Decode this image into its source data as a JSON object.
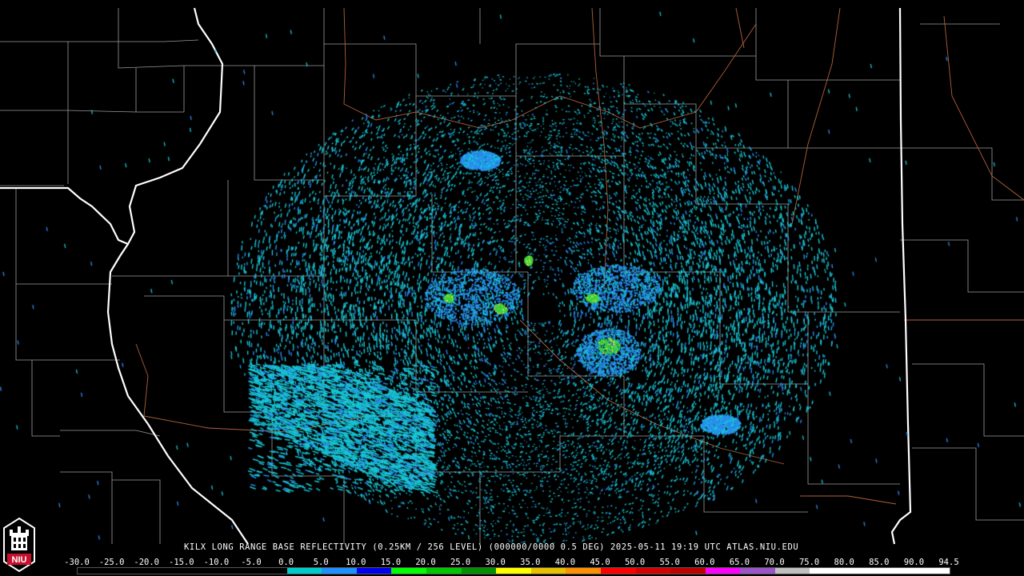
{
  "product_title": "KILX LONG RANGE BASE REFLECTIVITY (0.25KM / 256 LEVEL) (000000/0000 0.5 DEG) 2025-05-11 19:19 UTC  ATLAS.NIU.EDU",
  "logo": {
    "text": "NIU",
    "color": "#c8102e"
  },
  "colorscale": {
    "labels": [
      "-30.0",
      "-25.0",
      "-20.0",
      "-15.0",
      "-10.0",
      "-5.0",
      "0.0",
      "5.0",
      "10.0",
      "15.0",
      "20.0",
      "25.0",
      "30.0",
      "35.0",
      "40.0",
      "45.0",
      "50.0",
      "55.0",
      "60.0",
      "65.0",
      "70.0",
      "75.0",
      "80.0",
      "85.0",
      "90.0",
      "94.5"
    ],
    "colors": [
      "#000000",
      "#000000",
      "#000000",
      "#000000",
      "#000000",
      "#000000",
      "#00cccc",
      "#1e90ff",
      "#0000f0",
      "#00ff00",
      "#00c800",
      "#009000",
      "#ffff00",
      "#e7c000",
      "#ff9000",
      "#ff0000",
      "#d60000",
      "#c00000",
      "#ff00ff",
      "#9955c9",
      "#c0c0c0",
      "#ffffff",
      "#ffffff",
      "#ffffff",
      "#ffffff"
    ]
  },
  "map_colors": {
    "state_border": "#ffffff",
    "county_border": "#9a9a9a",
    "highway": "#b0603a",
    "echo_primary": "#19c6d6",
    "echo_secondary": "#2a8cf0",
    "echo_strong": "#3cd23c",
    "echo_peak": "#f0e040"
  }
}
